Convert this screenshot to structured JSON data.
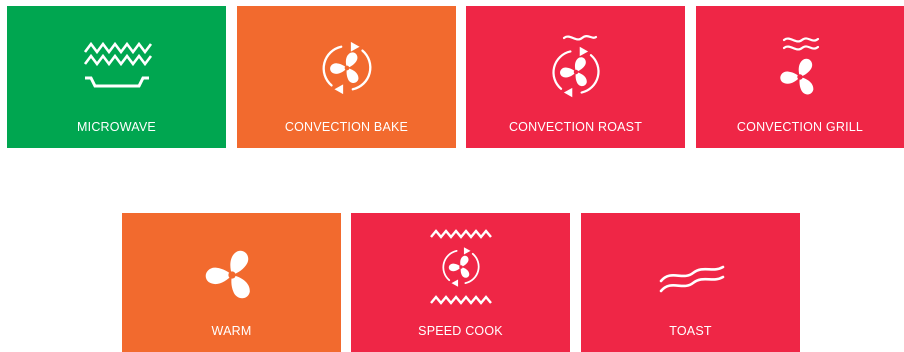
{
  "colors": {
    "green": "#00A650",
    "orange": "#F26A2E",
    "red": "#EF2646",
    "text": "#FFFFFF"
  },
  "modes": [
    {
      "label": "MICROWAVE",
      "color": "#00A650",
      "icon": "microwave-waves-dish-icon"
    },
    {
      "label": "CONVECTION BAKE",
      "color": "#F26A2E",
      "icon": "fan-circular-arrows-icon"
    },
    {
      "label": "CONVECTION ROAST",
      "color": "#EF2646",
      "icon": "fan-arrows-heat-wave-icon"
    },
    {
      "label": "CONVECTION GRILL",
      "color": "#EF2646",
      "icon": "fan-heat-waves-icon"
    },
    {
      "label": "WARM",
      "color": "#F26A2E",
      "icon": "fan-icon"
    },
    {
      "label": "SPEED COOK",
      "color": "#EF2646",
      "icon": "fan-arrows-zigzag-icon"
    },
    {
      "label": "TOAST",
      "color": "#EF2646",
      "icon": "heat-waves-icon"
    }
  ]
}
